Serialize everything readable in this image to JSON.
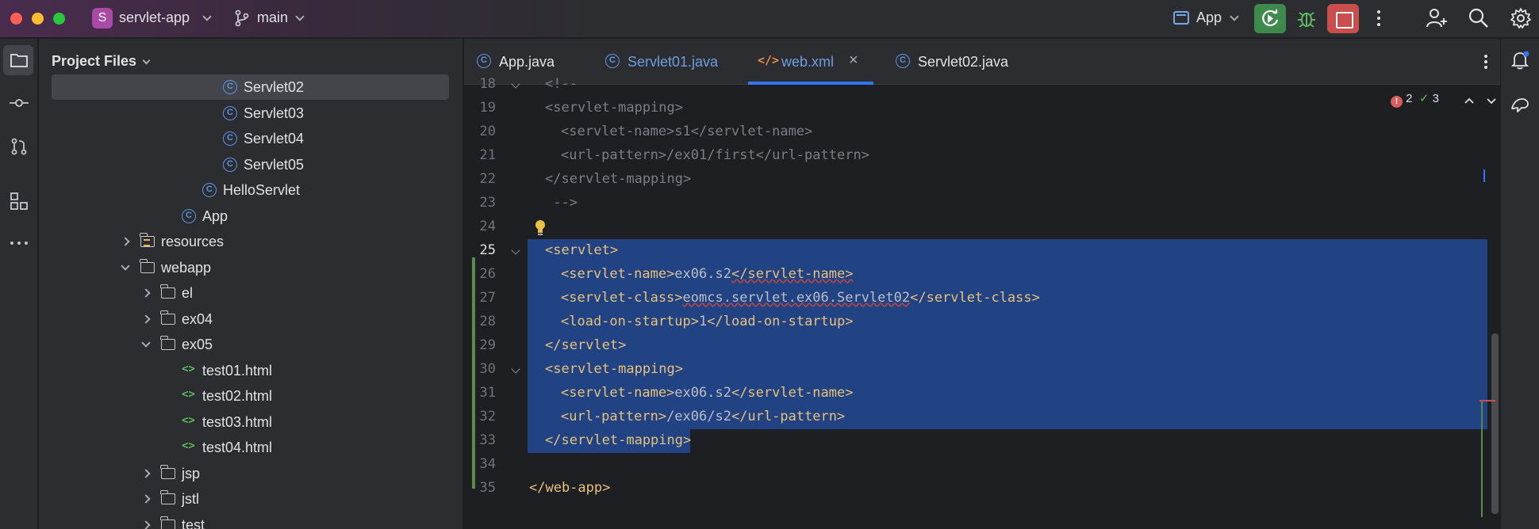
{
  "window": {
    "project_initial": "S",
    "project_name": "servlet-app",
    "branch": "main",
    "run_config": "App"
  },
  "project_panel": {
    "title": "Project Files",
    "rows": [
      {
        "label": "Servlet02",
        "type": "class",
        "depth": 8,
        "selected": true
      },
      {
        "label": "Servlet03",
        "type": "class",
        "depth": 8
      },
      {
        "label": "Servlet04",
        "type": "class",
        "depth": 8
      },
      {
        "label": "Servlet05",
        "type": "class",
        "depth": 8
      },
      {
        "label": "HelloServlet",
        "type": "class",
        "depth": 7
      },
      {
        "label": "App",
        "type": "class",
        "depth": 6
      },
      {
        "label": "resources",
        "type": "resources",
        "depth": 4,
        "arrow": "right"
      },
      {
        "label": "webapp",
        "type": "folder",
        "depth": 4,
        "arrow": "down"
      },
      {
        "label": "el",
        "type": "folder",
        "depth": 5,
        "arrow": "right"
      },
      {
        "label": "ex04",
        "type": "folder",
        "depth": 5,
        "arrow": "right"
      },
      {
        "label": "ex05",
        "type": "folder",
        "depth": 5,
        "arrow": "down"
      },
      {
        "label": "test01.html",
        "type": "html",
        "depth": 6
      },
      {
        "label": "test02.html",
        "type": "html",
        "depth": 6
      },
      {
        "label": "test03.html",
        "type": "html",
        "depth": 6
      },
      {
        "label": "test04.html",
        "type": "html",
        "depth": 6
      },
      {
        "label": "jsp",
        "type": "folder",
        "depth": 5,
        "arrow": "right"
      },
      {
        "label": "jstl",
        "type": "folder",
        "depth": 5,
        "arrow": "right"
      },
      {
        "label": "test",
        "type": "folder",
        "depth": 5,
        "arrow": "right"
      }
    ]
  },
  "tabs": [
    {
      "label": "App.java",
      "icon": "class",
      "color": "#dfe1e5"
    },
    {
      "label": "Servlet01.java",
      "icon": "class",
      "color": "#6f9de0"
    },
    {
      "label": "web.xml",
      "icon": "xml",
      "color": "#6f9de0",
      "active": true,
      "closable": true
    },
    {
      "label": "Servlet02.java",
      "icon": "class",
      "color": "#dfe1e5"
    }
  ],
  "inspections": {
    "errors": "2",
    "warnings": "3"
  },
  "code_lines": [
    {
      "n": "18",
      "text": "<!--",
      "kind": "comment",
      "indent": 1
    },
    {
      "n": "19",
      "text": "<servlet-mapping>",
      "kind": "comment",
      "indent": 1
    },
    {
      "n": "20",
      "text": "<servlet-name>s1</servlet-name>",
      "kind": "comment",
      "indent": 2
    },
    {
      "n": "21",
      "text": "<url-pattern>/ex01/first</url-pattern>",
      "kind": "comment",
      "indent": 2
    },
    {
      "n": "22",
      "text": "</servlet-mapping>",
      "kind": "comment",
      "indent": 1
    },
    {
      "n": "23",
      "text": " -->",
      "kind": "comment",
      "indent": 1
    },
    {
      "n": "24",
      "text": "",
      "kind": "plain",
      "indent": 0
    },
    {
      "n": "25",
      "open": "<servlet>",
      "kind": "tag",
      "indent": 1,
      "hl": true,
      "fold": true
    },
    {
      "n": "26",
      "open": "<servlet-name>",
      "body": "ex06.s2",
      "close": "</servlet-name>",
      "kind": "tag",
      "indent": 2,
      "hl": true,
      "err": true
    },
    {
      "n": "27",
      "open": "<servlet-class>",
      "body": "eomcs.servlet.ex06.Servlet02",
      "close": "</servlet-class>",
      "kind": "tag",
      "indent": 2,
      "hl": true,
      "errBody": true
    },
    {
      "n": "28",
      "open": "<load-on-startup>",
      "body": "1",
      "close": "</load-on-startup>",
      "kind": "tag",
      "indent": 2,
      "hl": true
    },
    {
      "n": "29",
      "open": "</servlet>",
      "kind": "tag",
      "indent": 1,
      "hl": true
    },
    {
      "n": "30",
      "open": "<servlet-mapping>",
      "kind": "tag",
      "indent": 1,
      "hl": true,
      "fold": true
    },
    {
      "n": "31",
      "open": "<servlet-name>",
      "body": "ex06.s2",
      "close": "</servlet-name>",
      "kind": "tag",
      "indent": 2,
      "hl": true
    },
    {
      "n": "32",
      "open": "<url-pattern>",
      "body": "/ex06/s2",
      "close": "</url-pattern>",
      "kind": "tag",
      "indent": 2,
      "hl": true
    },
    {
      "n": "33",
      "open": "</servlet-mapping>",
      "kind": "tag",
      "indent": 1,
      "hl": "partial"
    },
    {
      "n": "34",
      "text": "",
      "kind": "plain",
      "indent": 0
    },
    {
      "n": "35",
      "open": "</web-app>",
      "kind": "tag",
      "indent": 0
    }
  ]
}
